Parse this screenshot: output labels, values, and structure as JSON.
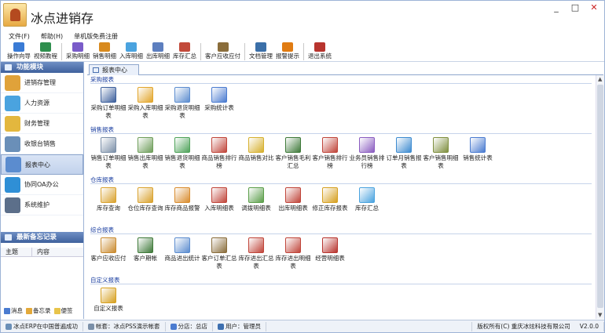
{
  "window": {
    "title": "冰点进销存",
    "controls": [
      "_",
      "□",
      "✕"
    ]
  },
  "menu": [
    "文件(F)",
    "帮助(H)",
    "单机版免费注册"
  ],
  "toolbar": [
    {
      "label": "操作向导",
      "icon": "wizard-icon",
      "color": "#3a7bd5"
    },
    {
      "label": "视频教程",
      "icon": "video-icon",
      "color": "#2f8f4e"
    },
    {
      "label": "采购明细",
      "icon": "purchase-detail-icon",
      "color": "#7a5cc9"
    },
    {
      "label": "销售明细",
      "icon": "sales-detail-icon",
      "color": "#d88a1e"
    },
    {
      "label": "入库明细",
      "icon": "stock-in-icon",
      "color": "#4aa3df"
    },
    {
      "label": "出库明细",
      "icon": "stock-out-icon",
      "color": "#5d7fbf"
    },
    {
      "label": "库存汇总",
      "icon": "inventory-summary-icon",
      "color": "#c24a3a"
    },
    {
      "label": "客户应收应付",
      "icon": "receivable-icon",
      "color": "#8a6d3b"
    },
    {
      "label": "文档管理",
      "icon": "document-icon",
      "color": "#3b6fa8"
    },
    {
      "label": "报警提示",
      "icon": "alarm-icon",
      "color": "#e07b12"
    },
    {
      "label": "退出系统",
      "icon": "exit-icon",
      "color": "#b8342e"
    }
  ],
  "left_panel": {
    "title": "功能模块",
    "items": [
      {
        "label": "进销存管理",
        "icon": "package-icon",
        "color": "#e0a23a",
        "active": false
      },
      {
        "label": "人力资源",
        "icon": "people-icon",
        "color": "#4aa3df",
        "active": false
      },
      {
        "label": "财务管理",
        "icon": "finance-icon",
        "color": "#e3b73e",
        "active": false
      },
      {
        "label": "收银台销售",
        "icon": "cashier-icon",
        "color": "#6a8fb8",
        "active": false
      },
      {
        "label": "报表中心",
        "icon": "report-icon",
        "color": "#5b8ccf",
        "active": true
      },
      {
        "label": "协同OA办公",
        "icon": "oa-icon",
        "color": "#2f8fd6",
        "active": false
      },
      {
        "label": "系统维护",
        "icon": "tools-icon",
        "color": "#5c6f8a",
        "active": false
      }
    ],
    "memo_title": "最新备忘记录",
    "memo_columns": [
      "主题",
      "内容"
    ],
    "memo_links": [
      {
        "label": "消息",
        "icon": "message-icon",
        "color": "#4a7bd0"
      },
      {
        "label": "备忘录",
        "icon": "memo-icon",
        "color": "#e3a93a"
      },
      {
        "label": "便签",
        "icon": "note-icon",
        "color": "#e8c44a"
      }
    ]
  },
  "tab": {
    "label": "报表中心"
  },
  "sections": [
    {
      "title": "采购报表",
      "items": [
        {
          "label": "采购订单明细表",
          "icon": "purchase-order-icon",
          "color": "#3c5f9c"
        },
        {
          "label": "采购入库明细表",
          "icon": "purchase-in-icon",
          "color": "#e2a52a"
        },
        {
          "label": "采购退货明细表",
          "icon": "purchase-return-icon",
          "color": "#5b8ccf"
        },
        {
          "label": "采购统计表",
          "icon": "purchase-stat-icon",
          "color": "#4a7bd0"
        }
      ]
    },
    {
      "title": "销售报表",
      "items": [
        {
          "label": "销售订单明细表",
          "icon": "sales-order-icon",
          "color": "#7b8fa8"
        },
        {
          "label": "销售出库明细表",
          "icon": "sales-out-icon",
          "color": "#6f9e5b"
        },
        {
          "label": "销售退货明细表",
          "icon": "sales-return-icon",
          "color": "#4fa35a"
        },
        {
          "label": "商品销售排行榜",
          "icon": "ranking-icon",
          "color": "#c0453a"
        },
        {
          "label": "商品销售对比",
          "icon": "compare-icon",
          "color": "#d6b02e"
        },
        {
          "label": "客户销售毛利汇总",
          "icon": "profit-icon",
          "color": "#3f7a3a"
        },
        {
          "label": "客户销售排行榜",
          "icon": "customer-rank-icon",
          "color": "#c0453a"
        },
        {
          "label": "业务员销售排行榜",
          "icon": "salesman-rank-icon",
          "color": "#8a5cc0"
        },
        {
          "label": "订单月销售报表",
          "icon": "clock-icon",
          "color": "#3d8bd0"
        },
        {
          "label": "客户销售明细表",
          "icon": "customer-detail-icon",
          "color": "#7f8f3f"
        },
        {
          "label": "销售统计表",
          "icon": "sales-stat-icon",
          "color": "#4a7bd0"
        }
      ]
    },
    {
      "title": "仓库报表",
      "items": [
        {
          "label": "库存查询",
          "icon": "inventory-search-icon",
          "color": "#d9a22e"
        },
        {
          "label": "仓位库存查询",
          "icon": "location-search-icon",
          "color": "#d9a22e"
        },
        {
          "label": "库存商品报警",
          "icon": "alarm-box-icon",
          "color": "#d98c2e"
        },
        {
          "label": "入库明细表",
          "icon": "stock-in-detail-icon",
          "color": "#c0453a"
        },
        {
          "label": "调拨明细表",
          "icon": "transfer-icon",
          "color": "#5b9e4a"
        },
        {
          "label": "出库明细表",
          "icon": "stock-out-detail-icon",
          "color": "#c0453a"
        },
        {
          "label": "修正库存报表",
          "icon": "adjust-icon",
          "color": "#d6a020"
        },
        {
          "label": "库存汇总",
          "icon": "funnel-icon",
          "color": "#4aa3df"
        }
      ]
    },
    {
      "title": "综合报表",
      "items": [
        {
          "label": "客户应收应付",
          "icon": "account-icon",
          "color": "#c98a2e"
        },
        {
          "label": "客户期帐",
          "icon": "ledger-icon",
          "color": "#3f7a3a"
        },
        {
          "label": "商品进出统计",
          "icon": "in-out-stat-icon",
          "color": "#5b8ccf"
        },
        {
          "label": "客户订单汇总表",
          "icon": "customer-order-icon",
          "color": "#8a6d3b"
        },
        {
          "label": "库存进出汇总表",
          "icon": "stock-flow-icon",
          "color": "#c0453a"
        },
        {
          "label": "库存进出明细表",
          "icon": "stock-flow-detail-icon",
          "color": "#c0453a"
        },
        {
          "label": "经营明细表",
          "icon": "business-icon",
          "color": "#b8342e"
        }
      ]
    },
    {
      "title": "自定义报表",
      "items": [
        {
          "label": "自定义报表",
          "icon": "custom-report-icon",
          "color": "#d6a020"
        }
      ]
    }
  ],
  "statusbar": {
    "message": "冰点ERP在中国普遍成功",
    "account": "帐套：冰点PSS演示帐套",
    "branch": "分店：总店",
    "user": "用户：管理员",
    "copyright": "版权所有(C) 重庆冰炫科技有限公司",
    "version": "V2.0.0"
  }
}
